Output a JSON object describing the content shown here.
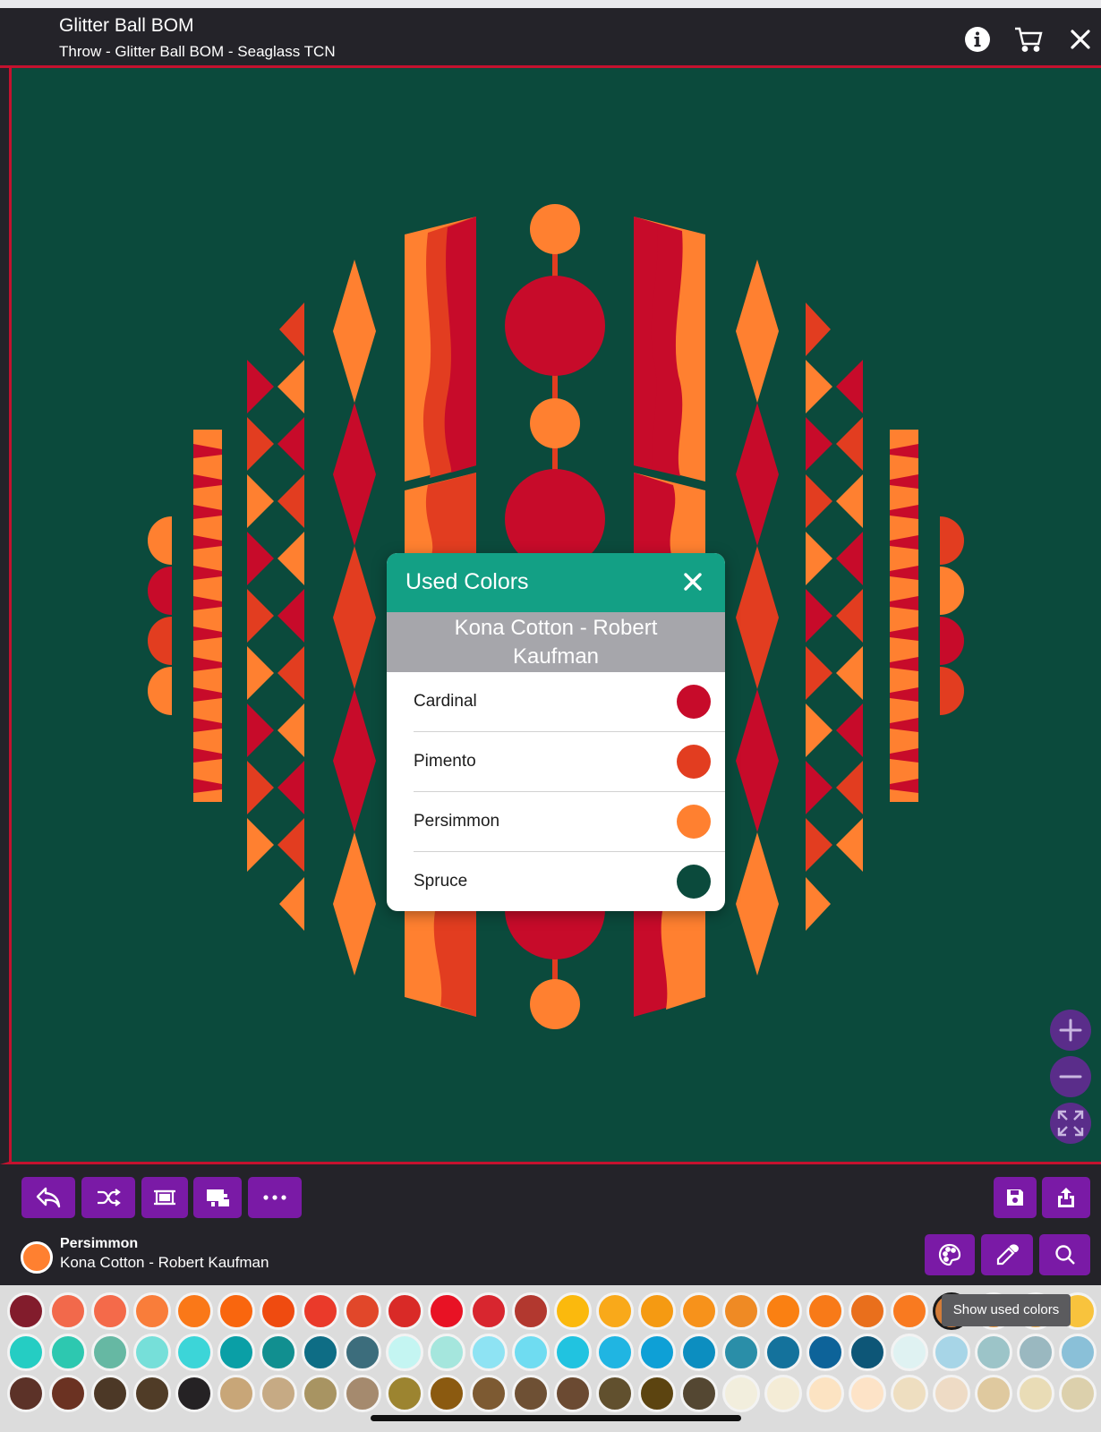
{
  "header": {
    "title": "Glitter Ball BOM",
    "subtitle": "Throw - Glitter Ball BOM - Seaglass TCN",
    "icons": [
      "info-icon",
      "cart-icon",
      "close-icon"
    ]
  },
  "colors": {
    "cardinal": "#c70b2a",
    "pimento": "#e23d20",
    "persimmon": "#ff8030",
    "spruce": "#0b4a3c",
    "accent": "#7a1aa6",
    "popup_header": "#13a085"
  },
  "used_colors": {
    "title": "Used Colors",
    "manufacturer": "Kona Cotton - Robert Kaufman",
    "items": [
      {
        "name": "Cardinal",
        "color": "#c70b2a"
      },
      {
        "name": "Pimento",
        "color": "#e23d20"
      },
      {
        "name": "Persimmon",
        "color": "#ff8030"
      },
      {
        "name": "Spruce",
        "color": "#0b4a3c"
      }
    ]
  },
  "toolbar": {
    "left": [
      "undo-icon",
      "shuffle-icon",
      "frame-icon",
      "display-icon",
      "more-icon"
    ],
    "right": [
      "save-icon",
      "share-icon"
    ]
  },
  "selected": {
    "name": "Persimmon",
    "line": "Kona Cotton - Robert Kaufman",
    "color": "#ff8030"
  },
  "tools": [
    "palette-icon",
    "eyedropper-icon",
    "search-icon"
  ],
  "tooltip": "Show used colors",
  "palette_rows": [
    [
      "#821c2c",
      "#f2694b",
      "#f46a4a",
      "#f97d3a",
      "#fa7818",
      "#f9660e",
      "#ef4b10",
      "#ea3a2a",
      "#e1472a",
      "#d92a27",
      "#e81224",
      "#d8262f",
      "#b2382f",
      "#fbb90d",
      "#f9a91a",
      "#f59a12",
      "#f7921b",
      "#ef8a24",
      "#fa8012",
      "#f87a18",
      "#e96f1c",
      "#f97a20",
      "#d37c38",
      "#f5a044",
      "#f5b85a",
      "#f8c33d"
    ],
    [
      "#25cdc3",
      "#2dc8b0",
      "#66b8a3",
      "#76dfd9",
      "#3cd5d8",
      "#0a9fa6",
      "#118f90",
      "#0e6d85",
      "#3c6d7c",
      "#c4f5f2",
      "#a5e6dd",
      "#8ee3f3",
      "#6fdcf1",
      "#21c3e0",
      "#20b5e2",
      "#0ea0d6",
      "#0c8ec0",
      "#2a8ea8",
      "#14729c",
      "#0d6399",
      "#0d5677",
      "#dff2f2",
      "#a7d5e7",
      "#9cc4c8",
      "#9ab8c0",
      "#8ac0d8"
    ],
    [
      "#5c3228",
      "#6b3222",
      "#4c3826",
      "#503c27",
      "#252224",
      "#c8a678",
      "#c6aa84",
      "#a89462",
      "#a58a6e",
      "#9c8430",
      "#8b5a10",
      "#7d5a32",
      "#6e5034",
      "#6b4a32",
      "#61502e",
      "#5c4410",
      "#544732",
      "#f2eedd",
      "#f4ecd6",
      "#fce3c2",
      "#fde3c7",
      "#eedec0",
      "#eedbc5",
      "#dfc99f",
      "#e9dcb6",
      "#dcd0ac"
    ]
  ]
}
